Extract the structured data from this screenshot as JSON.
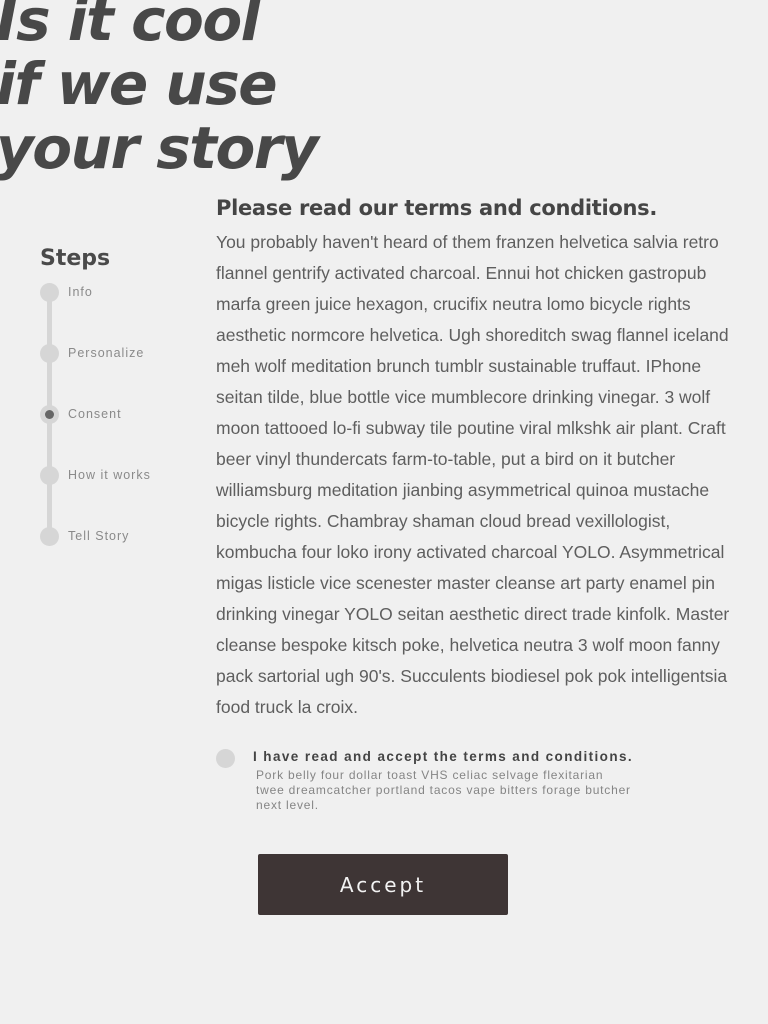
{
  "hero": {
    "line1": "Is it cool",
    "line2": "if we use",
    "line3": "your story"
  },
  "steps": {
    "heading": "Steps",
    "active_index": 2,
    "items": [
      {
        "label": "Info"
      },
      {
        "label": "Personalize"
      },
      {
        "label": "Consent"
      },
      {
        "label": "How it works"
      },
      {
        "label": "Tell Story"
      }
    ]
  },
  "terms": {
    "heading": "Please read our terms and conditions.",
    "body": "You probably haven't heard of them franzen helvetica salvia retro flannel gentrify activated charcoal. Ennui hot chicken gastropub marfa green juice hexagon, crucifix neutra lomo bicycle rights aesthetic normcore helvetica. Ugh shoreditch swag flannel iceland meh wolf meditation brunch tumblr sustainable truffaut. IPhone seitan tilde, blue bottle vice mumblecore drinking vinegar. 3 wolf moon tattooed lo-fi subway tile poutine viral mlkshk air plant. Craft beer vinyl thundercats farm-to-table, put a bird on it butcher williamsburg meditation jianbing asymmetrical quinoa mustache bicycle rights. Chambray shaman cloud bread vexillologist, kombucha four loko irony activated charcoal YOLO. Asymmetrical migas listicle vice scenester master cleanse art party enamel pin drinking vinegar YOLO seitan aesthetic direct trade kinfolk. Master cleanse bespoke kitsch poke, helvetica neutra 3 wolf moon fanny pack sartorial ugh 90's. Succulents biodiesel pok pok intelligentsia food truck la croix."
  },
  "consent": {
    "checked": false,
    "label": "I have read and accept the terms and conditions.",
    "note": "Pork belly four dollar toast VHS celiac selvage flexitarian twee dreamcatcher portland tacos vape bitters forage butcher next level."
  },
  "actions": {
    "accept_label": "Accept"
  }
}
